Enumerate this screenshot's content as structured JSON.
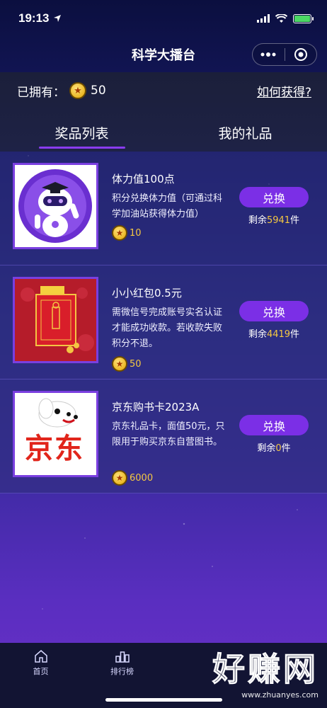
{
  "status_bar": {
    "time": "19:13"
  },
  "nav": {
    "title": "科学大播台"
  },
  "header": {
    "owned_label": "已拥有：",
    "owned_points": "50",
    "howto_link": "如何获得?"
  },
  "tabs": [
    {
      "label": "奖品列表",
      "active": true
    },
    {
      "label": "我的礼品",
      "active": false
    }
  ],
  "items": [
    {
      "name": "体力值100点",
      "desc": "积分兑换体力值（可通过科学加油站获得体力值）",
      "price": "10",
      "button": "兑换",
      "stock_prefix": "剩余",
      "stock_num": "5941",
      "stock_suffix": "件"
    },
    {
      "name": "小小红包0.5元",
      "desc": "需微信号完成账号实名认证才能成功收款。若收款失败积分不退。",
      "price": "50",
      "button": "兑换",
      "stock_prefix": "剩余",
      "stock_num": "4419",
      "stock_suffix": "件"
    },
    {
      "name": "京东购书卡2023A",
      "desc": "京东礼品卡，面值50元，只限用于购买京东自营图书。",
      "price": "6000",
      "button": "兑换",
      "stock_prefix": "剩余",
      "stock_num": "0",
      "stock_suffix": "件",
      "logo_text": "京东"
    }
  ],
  "tab_bar": [
    {
      "label": "首页",
      "icon": "home-icon"
    },
    {
      "label": "排行榜",
      "icon": "ranking-icon"
    }
  ],
  "watermark": {
    "big": "好赚网",
    "small": "www.zhuanyes.com"
  },
  "colors": {
    "accent": "#7b2fe6",
    "gold": "#f5c842"
  }
}
